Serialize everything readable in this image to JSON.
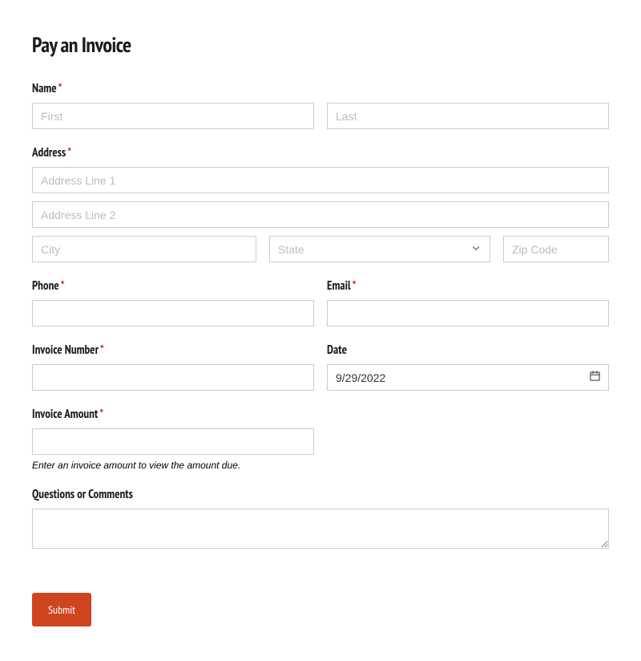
{
  "title": "Pay an Invoice",
  "required_marker": "*",
  "labels": {
    "name": "Name",
    "address": "Address",
    "phone": "Phone",
    "email": "Email",
    "invoice_number": "Invoice Number",
    "date": "Date",
    "invoice_amount": "Invoice Amount",
    "comments": "Questions or Comments"
  },
  "placeholders": {
    "first": "First",
    "last": "Last",
    "addr1": "Address Line 1",
    "addr2": "Address Line 2",
    "city": "City",
    "state": "State",
    "zip": "Zip Code"
  },
  "values": {
    "date": "9/29/2022"
  },
  "hints": {
    "amount": "Enter an invoice amount to view the amount due."
  },
  "buttons": {
    "submit": "Submit"
  }
}
